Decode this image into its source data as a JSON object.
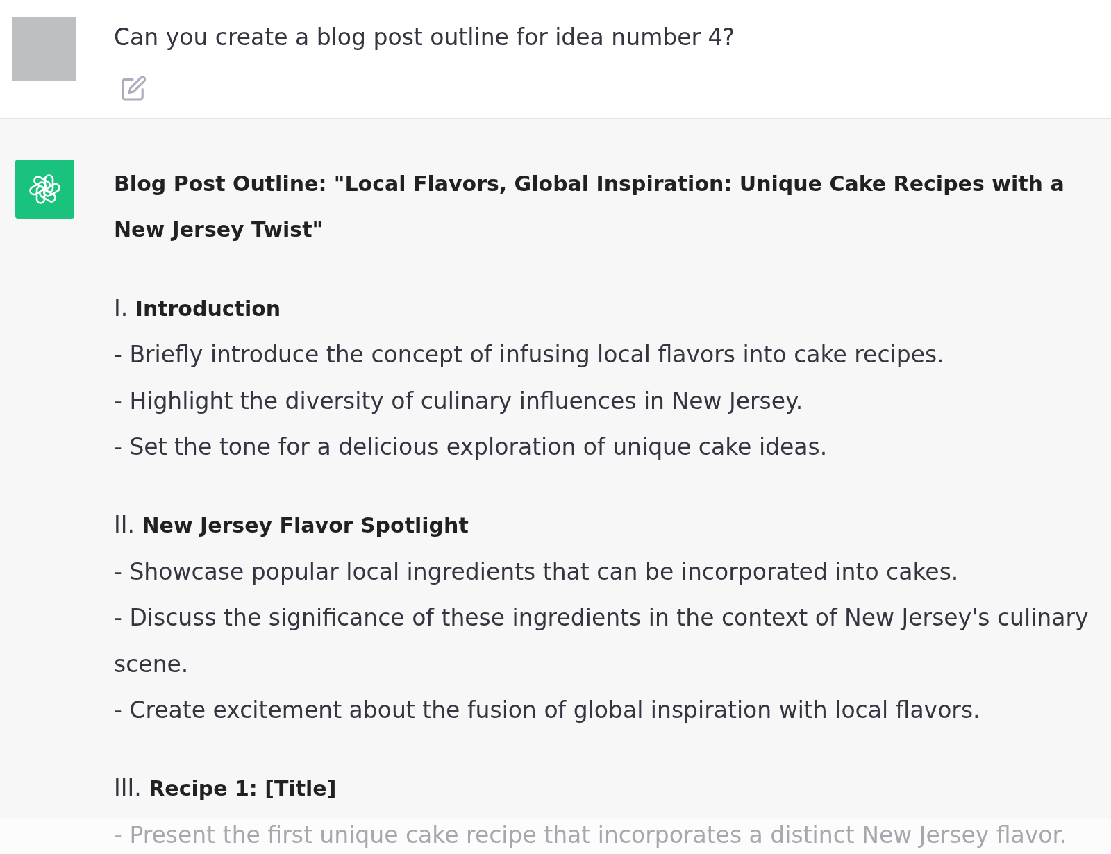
{
  "user_message": {
    "text": "Can you create a blog post outline for idea number 4?"
  },
  "assistant_message": {
    "title": "Blog Post Outline: \"Local Flavors, Global Inspiration: Unique Cake Recipes with a New Jersey Twist\"",
    "sections": [
      {
        "heading": "I. **Introduction**",
        "bullets": [
          {
            "text": "- Briefly introduce the concept of infusing local flavors into cake recipes.",
            "faded": false
          },
          {
            "text": "- Highlight the diversity of culinary influences in New Jersey.",
            "faded": false
          },
          {
            "text": "- Set the tone for a delicious exploration of unique cake ideas.",
            "faded": false
          }
        ]
      },
      {
        "heading": "II. **New Jersey Flavor Spotlight**",
        "bullets": [
          {
            "text": "- Showcase popular local ingredients that can be incorporated into cakes.",
            "faded": false
          },
          {
            "text": "- Discuss the significance of these ingredients in the context of New Jersey's culinary scene.",
            "faded": false
          },
          {
            "text": "- Create excitement about the fusion of global inspiration with local flavors.",
            "faded": false
          }
        ]
      },
      {
        "heading": "III. **Recipe 1: [Title]**",
        "bullets": [
          {
            "text": "- Present the first unique cake recipe that incorporates a distinct New Jersey flavor.",
            "faded": true
          }
        ]
      }
    ]
  }
}
